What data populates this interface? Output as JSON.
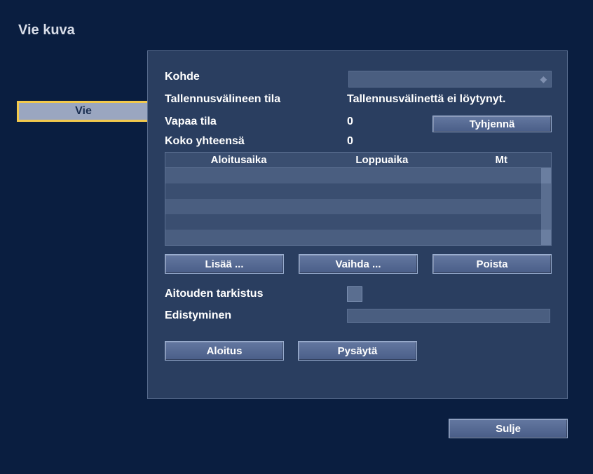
{
  "title": "Vie kuva",
  "tab": {
    "export": "Vie"
  },
  "fields": {
    "target_label": "Kohde",
    "target_value": "",
    "media_status_label": "Tallennusvälineen tila",
    "media_status_value": "Tallennusvälinettä ei löytynyt.",
    "free_space_label": "Vapaa tila",
    "free_space_value": "0",
    "total_size_label": "Koko yhteensä",
    "total_size_value": "0",
    "authenticity_label": "Aitouden tarkistus",
    "progress_label": "Edistyminen"
  },
  "buttons": {
    "clear": "Tyhjennä",
    "add": "Lisää ...",
    "change": "Vaihda ...",
    "delete": "Poista",
    "start": "Aloitus",
    "stop": "Pysäytä",
    "close": "Sulje"
  },
  "table": {
    "headers": {
      "start": "Aloitusaika",
      "end": "Loppuaika",
      "mb": "Mt"
    }
  }
}
